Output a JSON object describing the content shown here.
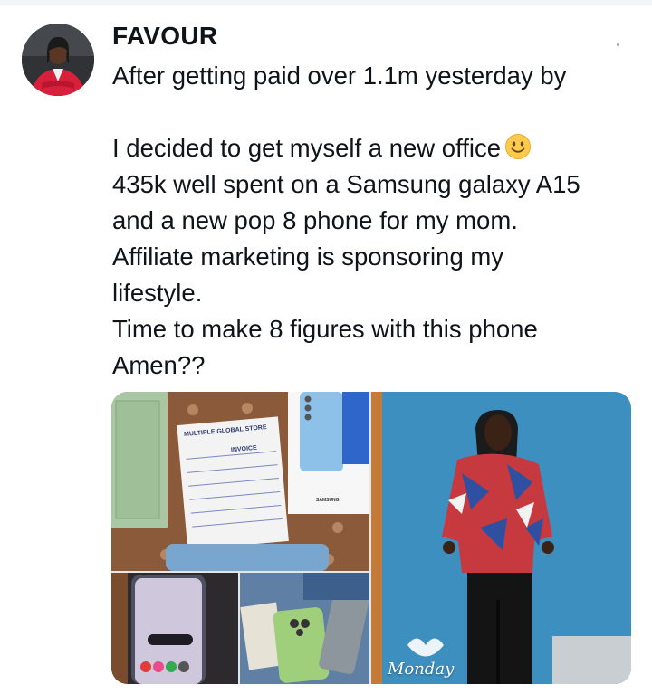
{
  "post": {
    "author": "FAVOUR",
    "lines": [
      "After getting paid over 1.1m yesterday by",
      "",
      "I decided to get myself a new office",
      "435k well spent on a Samsung galaxy A15",
      "and a new pop 8 phone for my mom.",
      "Affiliate marketing is sponsoring my",
      "lifestyle.",
      "Time to make 8 figures with this phone",
      "Amen??"
    ],
    "emoji": "slightly-smiling-face-icon"
  },
  "media": {
    "store_label": "MULTIPLE GLOBAL STORE",
    "invoice_label": "INVOICE",
    "box_brand": "SAMSUNG",
    "photo_caption": "Monday"
  },
  "colors": {
    "text": "#0f1419",
    "background": "#ffffff",
    "photo_wall": "#3d8fc0"
  }
}
